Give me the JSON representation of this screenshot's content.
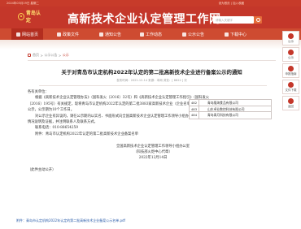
{
  "topbar": {
    "date": "2024年03月19日 星期二",
    "links": "设为首页 | 加入收藏"
  },
  "header": {
    "logo_text": "青岛认定",
    "site_title": "高新技术企业认定管理工作网",
    "search_placeholder": "请输入关键字"
  },
  "nav": {
    "items": [
      {
        "label": "网站首页"
      },
      {
        "label": "政策文件"
      },
      {
        "label": "通知公告"
      },
      {
        "label": "工作动态"
      },
      {
        "label": "公示公告"
      },
      {
        "label": "下载中心"
      }
    ]
  },
  "sidebar": {
    "items": [
      {
        "label": "公示"
      },
      {
        "label": "公示"
      },
      {
        "label": "申报指南"
      },
      {
        "label": "文件下载"
      },
      {
        "label": "返回"
      }
    ]
  },
  "breadcrumb": {
    "home": "首页",
    "sep": ">",
    "section": "公示公告",
    "current": "公示"
  },
  "article": {
    "title": "关于对青岛市认定机构2022年认定的第二批高新技术企业进行备案公示的通知",
    "meta": "发布时间：2022-12-14 来源：本网 浏览：[ 8822 ] 次",
    "paragraphs": [
      {
        "text": "各有关单位：",
        "cls": ""
      },
      {
        "text": "根据《高新技术企业认定管理办法》（国科发火〔2016〕32号）和《高新技术企业认定管理工作指引》（国科发火",
        "cls": "indent"
      },
      {
        "text": "〔2016〕195号）有关规定，现将青岛市认定机构2022年认定的第二批3883家高新技术企业（企业名单详见附件）进行备案",
        "cls": ""
      },
      {
        "text": "公示，公示期为10个工作日。",
        "cls": ""
      },
      {
        "text": "对公示企业有异议的，请在公示期内以实名、书面形式向全国高新技术企业认定管理工作领导小组办公室反映，提供",
        "cls": "indent"
      },
      {
        "text": "情况说明及证据，并注明联系人及联系方式。",
        "cls": ""
      },
      {
        "text": "联系电话：010-88654259",
        "cls": "indent"
      },
      {
        "text": "附件：青岛市认定机构2022年认定的第二批高新技术企业备案名单",
        "cls": "indent"
      },
      {
        "text": "",
        "cls": ""
      },
      {
        "text": "全国高新技术企业认定管理工作领导小组办公室",
        "cls": "center"
      },
      {
        "text": "（科技部火炬中心代章）",
        "cls": "center"
      },
      {
        "text": "2022年12月14日",
        "cls": "center"
      },
      {
        "text": "",
        "cls": ""
      },
      {
        "text": "（此件主动公开）",
        "cls": ""
      }
    ]
  },
  "table": {
    "rows": [
      {
        "no": "482",
        "name": "青岛隆海食品有限公司"
      },
      {
        "no": "483",
        "name": "山东卓业数控科技有限公司"
      },
      {
        "no": "484",
        "name": "青岛青月科技有限公司"
      }
    ]
  },
  "attachment": {
    "text": "附件：青岛市认定机构2022年认定的第二批高新技术企业备案公示名单.pdf"
  },
  "colors": {
    "brand_red": "#c4372a",
    "nav_red": "#ce4b31",
    "link_blue": "#2659a8"
  }
}
